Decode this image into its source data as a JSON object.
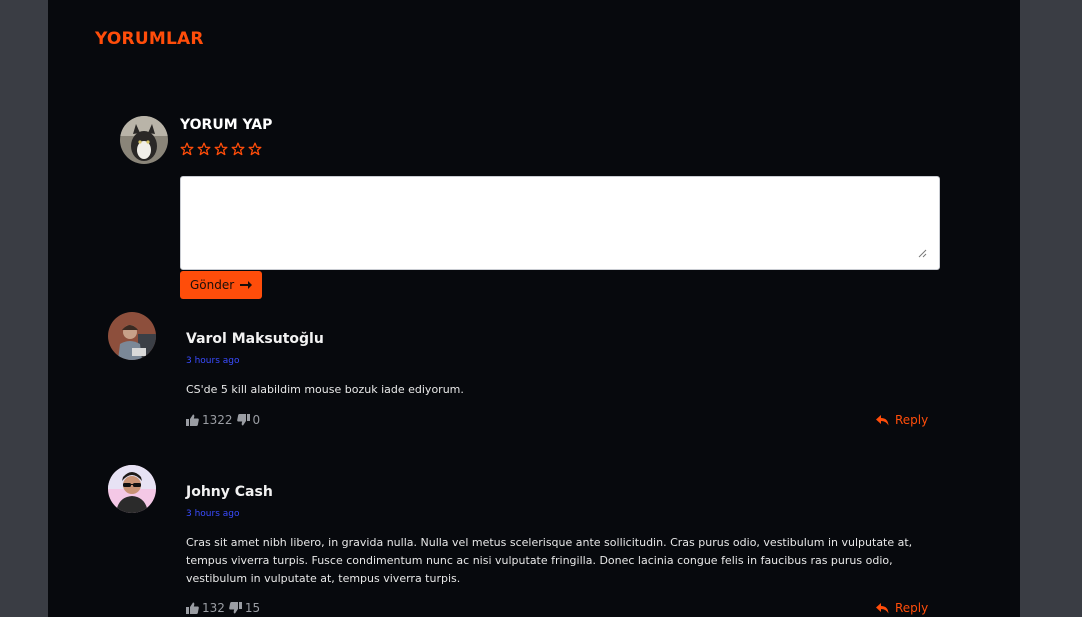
{
  "section": {
    "title": "YORUMLAR"
  },
  "compose": {
    "title": "YORUM YAP",
    "rating_stars": 5,
    "rating_value": 0,
    "textarea_value": "",
    "submit_label": "Gönder"
  },
  "comments": [
    {
      "author": "Varol Maksutoğlu",
      "time": "3 hours ago",
      "text": "CS'de 5 kill alabildim mouse bozuk iade ediyorum.",
      "likes": "1322",
      "dislikes": "0",
      "reply_label": "Reply"
    },
    {
      "author": "Johny Cash",
      "time": "3 hours ago",
      "text": "Cras sit amet nibh libero, in gravida nulla. Nulla vel metus scelerisque ante sollicitudin. Cras purus odio, vestibulum in vulputate at, tempus viverra turpis. Fusce condimentum nunc ac nisi vulputate fringilla. Donec lacinia congue felis in faucibus ras purus odio, vestibulum in vulputate at, tempus viverra turpis.",
      "likes": "132",
      "dislikes": "15",
      "reply_label": "Reply"
    }
  ],
  "colors": {
    "accent": "#ff4d0a",
    "timestamp": "#3a4cff",
    "panel_bg": "#07090d",
    "page_bg": "#3a3d44"
  }
}
